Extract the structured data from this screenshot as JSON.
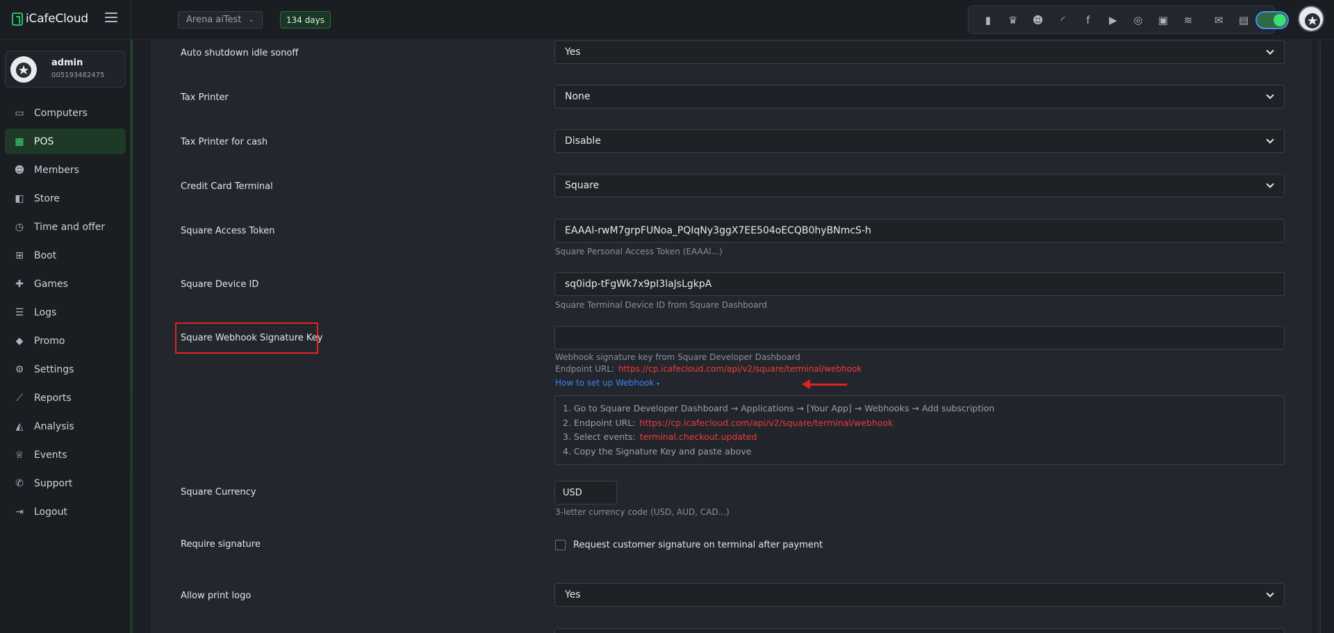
{
  "topbar": {
    "brand": "iCafeCloud",
    "cafe_name": "Arena aiTest",
    "days_badge": "134 days",
    "icons": [
      "leaderboard-icon",
      "trophy-icon",
      "members-icon",
      "rss-icon",
      "facebook-icon",
      "youtube-icon",
      "globe-icon",
      "icafe-icon",
      "cloud-sync-icon",
      "mail-icon",
      "chat-icon"
    ]
  },
  "user": {
    "name": "admin",
    "id": "005193482475"
  },
  "nav": [
    {
      "label": "Computers",
      "icon": "monitor-icon"
    },
    {
      "label": "POS",
      "icon": "cash-register-icon",
      "active": true
    },
    {
      "label": "Members",
      "icon": "users-icon"
    },
    {
      "label": "Store",
      "icon": "bag-icon"
    },
    {
      "label": "Time and offer",
      "icon": "clock-icon"
    },
    {
      "label": "Boot",
      "icon": "windows-icon"
    },
    {
      "label": "Games",
      "icon": "gamepad-icon"
    },
    {
      "label": "Logs",
      "icon": "list-icon"
    },
    {
      "label": "Promo",
      "icon": "tag-icon"
    },
    {
      "label": "Settings",
      "icon": "gear-icon"
    },
    {
      "label": "Reports",
      "icon": "line-chart-icon"
    },
    {
      "label": "Analysis",
      "icon": "area-chart-icon"
    },
    {
      "label": "Events",
      "icon": "crown-icon"
    },
    {
      "label": "Support",
      "icon": "phone-icon"
    },
    {
      "label": "Logout",
      "icon": "logout-icon"
    }
  ],
  "form": {
    "auto_shutdown": {
      "label": "Auto shutdown idle sonoff",
      "value": "Yes"
    },
    "tax_printer": {
      "label": "Tax Printer",
      "value": "None"
    },
    "tax_printer_cash": {
      "label": "Tax Printer for cash",
      "value": "Disable"
    },
    "credit_terminal": {
      "label": "Credit Card Terminal",
      "value": "Square"
    },
    "square_token": {
      "label": "Square Access Token",
      "value": "EAAAl-rwM7grpFUNoa_PQIqNy3ggX7EE504oECQB0hyBNmcS-h",
      "help": "Square Personal Access Token (EAAAl...)"
    },
    "square_device": {
      "label": "Square Device ID",
      "value": "sq0idp-tFgWk7x9pI3laJsLgkpA",
      "help": "Square Terminal Device ID from Square Dashboard"
    },
    "webhook_key": {
      "label": "Square Webhook Signature Key",
      "value": "",
      "help": "Webhook signature key from Square Developer Dashboard",
      "endpoint_label": "Endpoint URL:",
      "endpoint_url": "https://cp.icafecloud.com/api/v2/square/terminal/webhook",
      "howto": "How to set up Webhook",
      "steps": {
        "s1": "1. Go to Square Developer Dashboard → Applications → [Your App] → Webhooks → Add subscription",
        "s2_label": "2. Endpoint URL:",
        "s2_url": "https://cp.icafecloud.com/api/v2/square/terminal/webhook",
        "s3_label": "3. Select events:",
        "s3_event": "terminal.checkout.updated",
        "s4": "4. Copy the Signature Key and paste above"
      }
    },
    "currency": {
      "label": "Square Currency",
      "value": "USD",
      "help": "3-letter currency code (USD, AUD, CAD...)"
    },
    "require_signature": {
      "label": "Require signature",
      "checkbox_label": "Request customer signature on terminal after payment",
      "checked": false
    },
    "print_logo": {
      "label": "Allow print logo",
      "value": "Yes"
    }
  },
  "colors": {
    "accent": "#22c55e",
    "highlight": "#e02424",
    "link": "#3b82f6"
  }
}
